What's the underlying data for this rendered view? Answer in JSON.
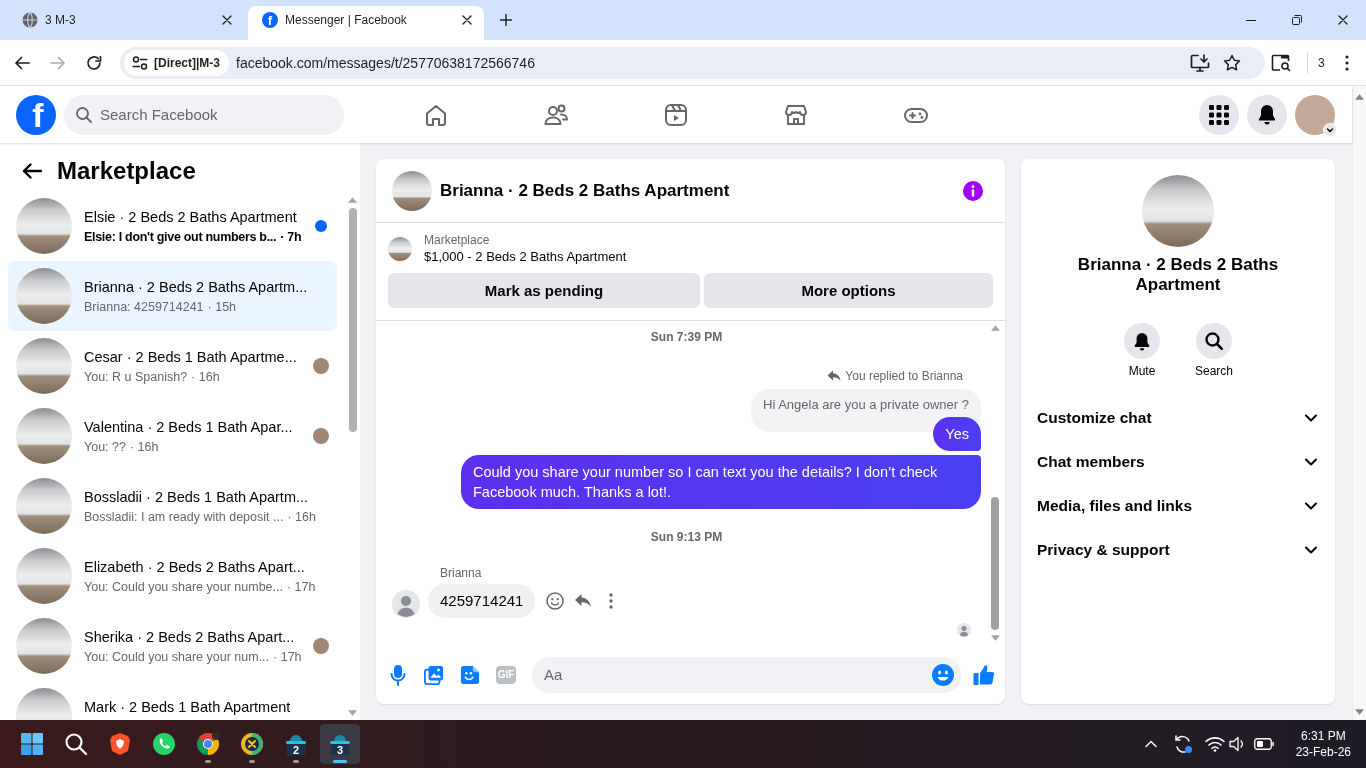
{
  "browser": {
    "tabs": [
      {
        "title": "3 M-3",
        "selected": false
      },
      {
        "title": "Messenger | Facebook",
        "icon_letter": "f",
        "selected": true
      }
    ],
    "forward_disabled": true,
    "address_bar": {
      "chip": "[Direct]|M-3",
      "url": "facebook.com/messages/t/25770638172566746"
    },
    "extension_badge": "3"
  },
  "facebook": {
    "logo": "f",
    "search": {
      "placeholder": "Search Facebook"
    }
  },
  "sidebar": {
    "title": "Marketplace",
    "conversations": [
      {
        "name": "Elsie · 2 Beds 2 Baths Apartment",
        "preview": "Elsie: I don't give out numbers b...",
        "time": "· 7h",
        "unread": true,
        "selected": false
      },
      {
        "name": "Brianna · 2 Beds 2 Baths Apartm...",
        "preview": "Brianna: 4259714241",
        "time": "· 15h",
        "unread": false,
        "seen": false,
        "selected": true
      },
      {
        "name": "Cesar · 2 Beds 1 Bath Apartme...",
        "preview": "You: R u Spanish?",
        "time": "· 16h",
        "unread": false,
        "seen": true,
        "selected": false
      },
      {
        "name": "Valentina · 2 Beds 1 Bath Apar...",
        "preview": "You: ??",
        "time": "· 16h",
        "unread": false,
        "seen": true,
        "selected": false
      },
      {
        "name": "Bossladii · 2 Beds 1 Bath Apartm...",
        "preview": "Bossladii: I am ready with deposit ...",
        "time": "· 16h",
        "unread": false,
        "seen": false,
        "selected": false
      },
      {
        "name": "Elizabeth · 2 Beds 2 Baths Apart...",
        "preview": "You: Could you share your numbe...",
        "time": "· 17h",
        "unread": false,
        "seen": false,
        "selected": false
      },
      {
        "name": "Sherika · 2 Beds 2 Baths Apart...",
        "preview": "You: Could you share your num...",
        "time": "· 17h",
        "unread": false,
        "seen": true,
        "selected": false
      },
      {
        "name": "Mark · 2 Beds 1 Bath Apartment",
        "selected": false
      }
    ]
  },
  "chat": {
    "title": "Brianna · 2 Beds 2 Baths Apartment",
    "listing": {
      "label": "Marketplace",
      "title": "$1,000 - 2 Beds 2 Baths Apartment"
    },
    "actions": [
      "Mark as pending",
      "More options"
    ],
    "messages": [
      {
        "kind": "time",
        "text": "Sun 7:39 PM"
      },
      {
        "kind": "reply_note",
        "text": "You replied to Brianna"
      },
      {
        "kind": "quote",
        "text": "Hi Angela are you a private owner ?"
      },
      {
        "kind": "outgoing",
        "text": "Yes"
      },
      {
        "kind": "outgoing",
        "text": "Could you share your number so I can text you the details? I don’t check Facebook much. Thanks a lot!."
      },
      {
        "kind": "time",
        "text": "Sun 9:13 PM"
      },
      {
        "kind": "sender",
        "text": "Brianna"
      },
      {
        "kind": "incoming",
        "text": "4259714241"
      }
    ],
    "seen": true,
    "composer": {
      "gif": "GIF",
      "placeholder": "Aa"
    }
  },
  "details": {
    "title": "Brianna · 2 Beds 2 Baths Apartment",
    "actions": [
      {
        "kind": "mute",
        "label": "Mute"
      },
      {
        "kind": "search",
        "label": "Search"
      }
    ],
    "sections": [
      {
        "label": "Customize chat",
        "expanded": false
      },
      {
        "label": "Chat members",
        "expanded": false
      },
      {
        "label": "Media, files and links",
        "expanded": false
      },
      {
        "label": "Privacy & support",
        "expanded": false
      }
    ]
  },
  "taskbar": {
    "apps": [
      {
        "kind": "start",
        "running": false,
        "selected": false
      },
      {
        "kind": "search",
        "running": false,
        "selected": false
      },
      {
        "kind": "shield",
        "running": false,
        "selected": false
      },
      {
        "kind": "phone",
        "running": false,
        "selected": false
      },
      {
        "kind": "browser",
        "running": true,
        "selected": false
      },
      {
        "kind": "cross",
        "running": true,
        "selected": false
      },
      {
        "kind": "profile",
        "label": "2",
        "running": true,
        "selected": false
      },
      {
        "kind": "profile",
        "label": "3",
        "running": true,
        "selected": true
      }
    ],
    "time": "6:31 PM",
    "date": "23-Feb-26"
  }
}
